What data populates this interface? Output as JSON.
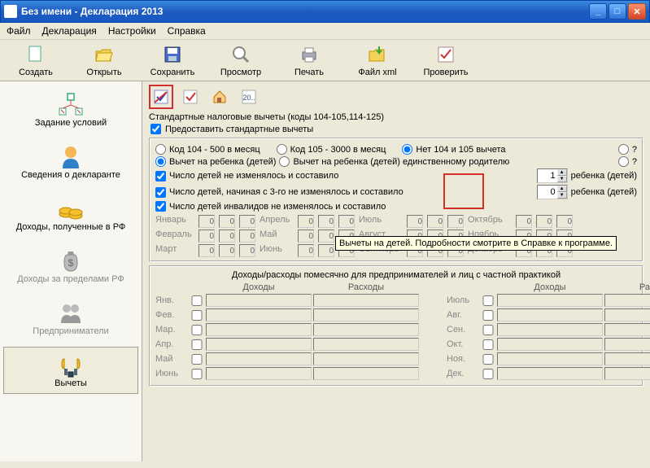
{
  "window": {
    "title": "Без имени - Декларация 2013"
  },
  "menubar": [
    "Файл",
    "Декларация",
    "Настройки",
    "Справка"
  ],
  "toolbar": [
    {
      "label": "Создать",
      "icon": "new"
    },
    {
      "label": "Открыть",
      "icon": "open"
    },
    {
      "label": "Сохранить",
      "icon": "save"
    },
    {
      "label": "Просмотр",
      "icon": "preview"
    },
    {
      "label": "Печать",
      "icon": "print"
    },
    {
      "label": "Файл xml",
      "icon": "xml"
    },
    {
      "label": "Проверить",
      "icon": "check"
    }
  ],
  "sidebar": [
    {
      "label": "Задание условий",
      "id": "conditions"
    },
    {
      "label": "Сведения о декларанте",
      "id": "declarant"
    },
    {
      "label": "Доходы, полученные в РФ",
      "id": "income-rf"
    },
    {
      "label": "Доходы за пределами РФ",
      "id": "income-abroad",
      "disabled": true
    },
    {
      "label": "Предприниматели",
      "id": "entrepreneurs",
      "disabled": true
    },
    {
      "label": "Вычеты",
      "id": "deductions",
      "active": true
    }
  ],
  "section": {
    "title": "Стандартные налоговые вычеты (коды 104-105,114-125)",
    "provide_standard": "Предоставить стандартные вычеты"
  },
  "radios": {
    "code104": "Код 104 - 500 в месяц",
    "code105": "Код 105 - 3000 в месяц",
    "none104105": "Нет 104 и 105 вычета",
    "child_ded": "Вычет на ребенка (детей)",
    "child_single": "Вычет на ребенка (детей) единственному родителю"
  },
  "childlines": {
    "line1": "Число детей не изменялось и составило",
    "line2": "Число детей, начиная с 3-го не изменялось и составило",
    "line3": "Число детей инвалидов не изменялось и составило",
    "suffix": "ребенка (детей)",
    "val1": "1",
    "val2": "0"
  },
  "months": [
    "Январь",
    "Февраль",
    "Март",
    "Апрель",
    "Май",
    "Июнь",
    "Июль",
    "Август",
    "Сентябрь",
    "Октябрь",
    "Ноябрь",
    "Декабрь"
  ],
  "month_val": "0",
  "incexp": {
    "title": "Доходы/расходы помесячно для предпринимателей и лиц с частной практикой",
    "income": "Доходы",
    "expense": "Расходы",
    "rows1": [
      "Янв.",
      "Фев.",
      "Мар.",
      "Апр.",
      "Май",
      "Июнь"
    ],
    "rows2": [
      "Июль",
      "Авг.",
      "Сен.",
      "Окт.",
      "Ноя.",
      "Дек."
    ]
  },
  "tooltip": "Вычеты на детей. Подробности смотрите в Справке к программе.",
  "qmark": "?"
}
